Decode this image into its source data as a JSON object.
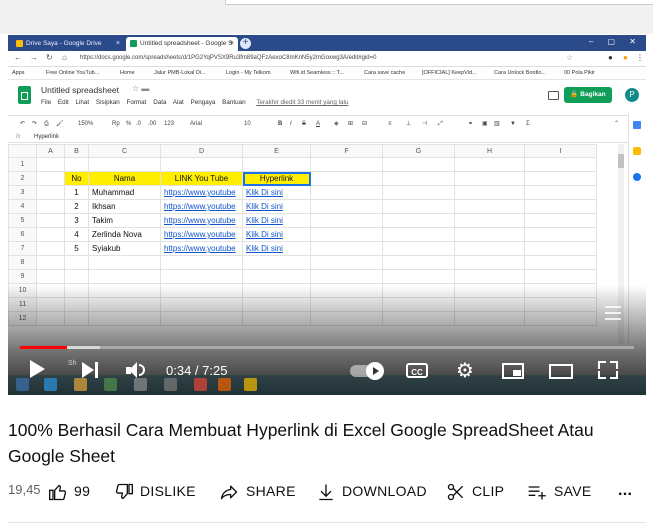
{
  "browser": {
    "tabs": [
      {
        "label": "Drive Saya - Google Drive",
        "color": "#fbbc04"
      },
      {
        "label": "Untitled spreadsheet - Google S",
        "color": "#0f9d58"
      }
    ],
    "new_tab": "+",
    "url": "https://docs.google.com/spreadsheets/d/1PG2YqPVSX9Ru3fm89aQFzAexoC8mKnN5y2mGoxwg3A/edit#gid=0",
    "bookmarks": [
      "Apps",
      "Free Online YouTub...",
      "Home",
      "Jalur PMB-Lokal Di...",
      "Login - My Telkom",
      "Wifi.id Seamless :: T...",
      "Cara save cache",
      "[OFFICIAL] KeepVid...",
      "Cara Unlock Bootlo...",
      "00 Pola Pikir"
    ]
  },
  "sheets": {
    "doc_title": "Untitled spreadsheet",
    "menu": [
      "File",
      "Edit",
      "Lihat",
      "Sisipkan",
      "Format",
      "Data",
      "Alat",
      "Pengaya",
      "Bantuan"
    ],
    "last_edit": "Terakhir diedit 33 menit yang lalu",
    "share_label": "Bagikan",
    "profile_initial": "P",
    "toolbar": {
      "zoom": "150%",
      "currency": "Rp",
      "percent": "%",
      "decimal_less": ".0",
      "decimal_more": ".00",
      "format_more": "123",
      "font": "Arial",
      "font_size": "10",
      "bold": "B",
      "italic": "I",
      "strike": "S",
      "text_color": "A",
      "sum": "Σ"
    },
    "formula_label": "fx",
    "formula_value": "Hyperlink",
    "columns": [
      "A",
      "B",
      "C",
      "D",
      "E",
      "F",
      "G",
      "H",
      "I"
    ],
    "rows": [
      {
        "n": "1",
        "b": "",
        "c": "",
        "d": "",
        "e": ""
      },
      {
        "n": "2",
        "b": "No",
        "c": "Nama",
        "d": "LINK You Tube",
        "e": "Hyperlink"
      },
      {
        "n": "3",
        "b": "1",
        "c": "Muhammad",
        "d": "https://www.youtube",
        "e": "Klik Di sini"
      },
      {
        "n": "4",
        "b": "2",
        "c": "Ikhsan",
        "d": "https://www.youtube",
        "e": "Klik Di sini"
      },
      {
        "n": "5",
        "b": "3",
        "c": "Takim",
        "d": "https://www.youtube",
        "e": "Klik Di sini"
      },
      {
        "n": "6",
        "b": "4",
        "c": "Zerlinda Nova",
        "d": "https://www.youtube",
        "e": "Klik Di sini"
      },
      {
        "n": "7",
        "b": "5",
        "c": "Syiakub",
        "d": "https://www.youtube",
        "e": "Klik Di sini"
      },
      {
        "n": "8",
        "b": "",
        "c": "",
        "d": "",
        "e": ""
      },
      {
        "n": "9",
        "b": "",
        "c": "",
        "d": "",
        "e": ""
      },
      {
        "n": "10",
        "b": "",
        "c": "",
        "d": "",
        "e": ""
      },
      {
        "n": "11",
        "b": "",
        "c": "",
        "d": "",
        "e": ""
      },
      {
        "n": "12",
        "b": "",
        "c": "",
        "d": "",
        "e": ""
      }
    ]
  },
  "player": {
    "time": "0:34 / 7:25",
    "progress_fraction": 0.076,
    "buffered_fraction": 0.13,
    "cc_label": "CC",
    "progress_color": "#ff0000"
  },
  "video": {
    "title": "100% Berhasil Cara Membuat Hyperlink di Excel Google SpreadSheet Atau Google Sheet",
    "views": "19,45",
    "likes": "99",
    "dislike_label": "DISLIKE",
    "share_label": "SHARE",
    "download_label": "DOWNLOAD",
    "clip_label": "CLIP",
    "save_label": "SAVE",
    "more_label": "..."
  },
  "icons": [
    "like-icon",
    "dislike-icon",
    "share-icon",
    "download-icon",
    "clip-icon",
    "save-icon",
    "more-icon",
    "play-icon",
    "next-icon",
    "volume-icon",
    "settings-icon",
    "miniplayer-icon",
    "theater-icon",
    "fullscreen-icon"
  ]
}
